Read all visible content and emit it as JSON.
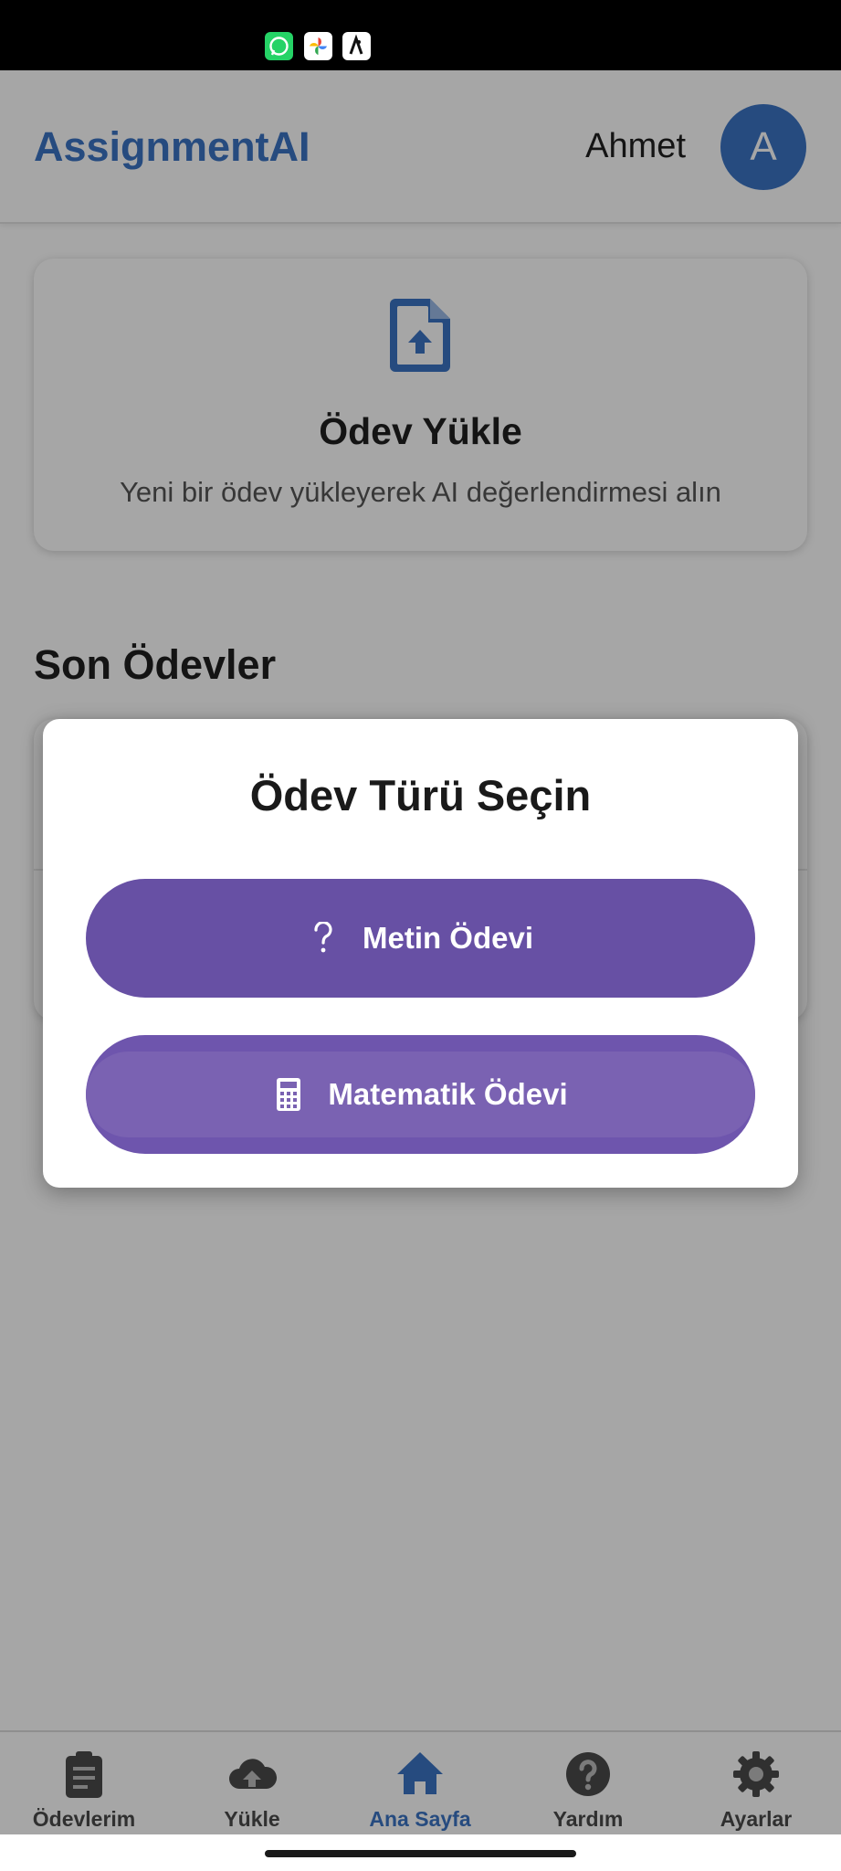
{
  "status_bar": {
    "icons": [
      "whatsapp-icon",
      "google-photos-icon",
      "app-notification-icon"
    ]
  },
  "header": {
    "brand": "AssignmentAI",
    "username": "Ahmet",
    "avatar_initial": "A"
  },
  "upload_card": {
    "icon": "file-upload-icon",
    "title": "Ödev Yükle",
    "description": "Yeni bir ödev yükleyerek AI değerlendirmesi alın"
  },
  "recent": {
    "title": "Son Ödevler"
  },
  "modal": {
    "title": "Ödev Türü Seçin",
    "buttons": [
      {
        "label": "Metin Ödevi",
        "icon": "question-icon"
      },
      {
        "label": "Matematik Ödevi",
        "icon": "calculator-icon"
      }
    ]
  },
  "bottom_nav": {
    "items": [
      {
        "label": "Ödevlerim",
        "icon": "clipboard-icon",
        "active": false
      },
      {
        "label": "Yükle",
        "icon": "cloud-upload-icon",
        "active": false
      },
      {
        "label": "Ana Sayfa",
        "icon": "home-icon",
        "active": true
      },
      {
        "label": "Yardım",
        "icon": "help-icon",
        "active": false
      },
      {
        "label": "Ayarlar",
        "icon": "settings-icon",
        "active": false
      }
    ]
  },
  "colors": {
    "primary": "#3b73c4",
    "modal_button": "#6750a4",
    "nav_inactive": "#4a4a4a"
  }
}
